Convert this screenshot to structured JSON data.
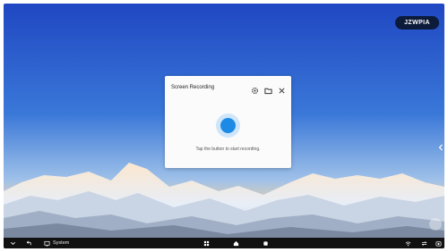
{
  "badge": {
    "label": "JZWPIA"
  },
  "dialog": {
    "title": "Screen Recording",
    "hint": "Tap the button to start recording.",
    "icons": [
      "gear-icon",
      "folder-icon",
      "close-icon"
    ],
    "accent": "#1d8be6"
  },
  "taskbar": {
    "system_label": "System",
    "icons": [
      "chevron-down-icon",
      "back-icon",
      "system-icon",
      "apps-grid-icon",
      "home-icon",
      "layers-icon",
      "wifi-icon",
      "swap-icon",
      "screenshot-icon"
    ]
  }
}
